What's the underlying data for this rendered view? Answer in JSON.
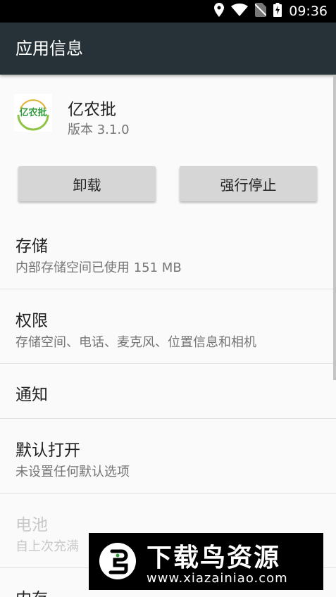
{
  "status_bar": {
    "time": "09:36",
    "icons": [
      "location-icon",
      "wifi-icon",
      "no-sim-icon",
      "battery-charging-icon"
    ]
  },
  "app_bar": {
    "title": "应用信息"
  },
  "app": {
    "icon_text": "亿农批",
    "name": "亿农批",
    "version": "版本 3.1.0",
    "icon_colors": {
      "text": "#2e9a3a",
      "ring": "#8fc445",
      "accent": "#e0b030"
    }
  },
  "buttons": {
    "uninstall": "卸载",
    "force_stop": "强行停止"
  },
  "settings": {
    "storage": {
      "title": "存储",
      "subtitle": "内部存储空间已使用 151 MB"
    },
    "permissions": {
      "title": "权限",
      "subtitle": "存储空间、电话、麦克风、位置信息和相机"
    },
    "notifications": {
      "title": "通知"
    },
    "open_by_default": {
      "title": "默认打开",
      "subtitle": "未设置任何默认选项"
    },
    "battery": {
      "title": "电池",
      "subtitle": "自上次充满"
    },
    "memory": {
      "title": "内存"
    }
  },
  "watermark": {
    "title": "下载鸟资源",
    "url": "www.xiazainiao.com"
  },
  "colors": {
    "app_bar": "#263238",
    "status_bar": "#000000",
    "background": "#fafafa",
    "button": "#d6d6d6",
    "secondary_text": "#757575",
    "disabled_text": "#c8c8c8"
  }
}
